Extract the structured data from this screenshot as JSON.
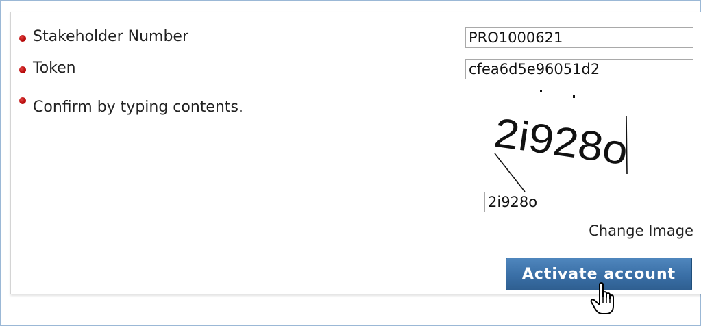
{
  "form": {
    "stakeholder_label": "Stakeholder Number",
    "stakeholder_value": "PRO1000621",
    "token_label": "Token",
    "token_value": "cfea6d5e96051d2",
    "confirm_label": "Confirm by typing contents.",
    "captcha_text": "2i928o",
    "captcha_input_value": "2i928o",
    "change_image_label": "Change Image",
    "activate_button_label": "Activate account"
  },
  "colors": {
    "required_bullet": "#c00000",
    "button": "#3a6fa6",
    "frame_border": "#9bb8d6"
  },
  "icons": {
    "required_marker": "red-dot-icon",
    "cursor": "hand-pointer-icon"
  }
}
